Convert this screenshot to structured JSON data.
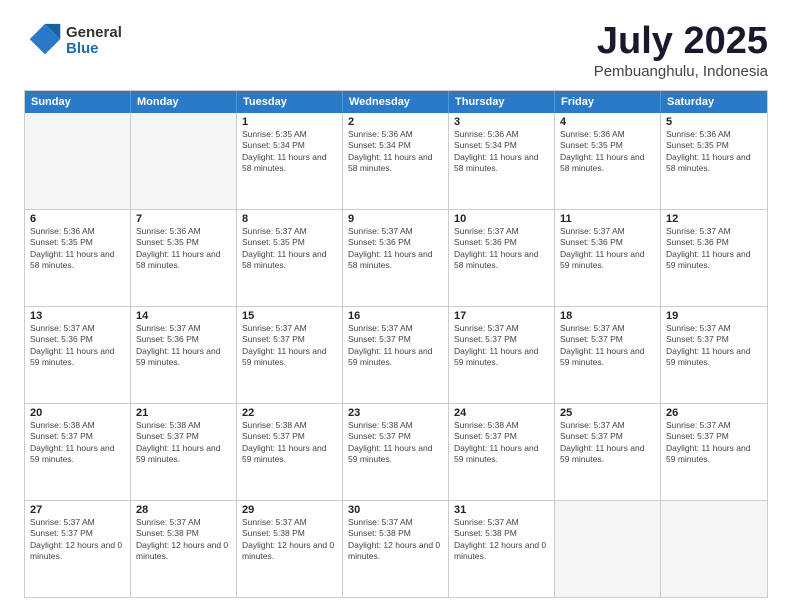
{
  "logo": {
    "general": "General",
    "blue": "Blue"
  },
  "header": {
    "month": "July 2025",
    "location": "Pembuanghulu, Indonesia"
  },
  "weekdays": [
    "Sunday",
    "Monday",
    "Tuesday",
    "Wednesday",
    "Thursday",
    "Friday",
    "Saturday"
  ],
  "weeks": [
    [
      {
        "day": "",
        "detail": ""
      },
      {
        "day": "",
        "detail": ""
      },
      {
        "day": "1",
        "detail": "Sunrise: 5:35 AM\nSunset: 5:34 PM\nDaylight: 11 hours and 58 minutes."
      },
      {
        "day": "2",
        "detail": "Sunrise: 5:36 AM\nSunset: 5:34 PM\nDaylight: 11 hours and 58 minutes."
      },
      {
        "day": "3",
        "detail": "Sunrise: 5:36 AM\nSunset: 5:34 PM\nDaylight: 11 hours and 58 minutes."
      },
      {
        "day": "4",
        "detail": "Sunrise: 5:36 AM\nSunset: 5:35 PM\nDaylight: 11 hours and 58 minutes."
      },
      {
        "day": "5",
        "detail": "Sunrise: 5:36 AM\nSunset: 5:35 PM\nDaylight: 11 hours and 58 minutes."
      }
    ],
    [
      {
        "day": "6",
        "detail": "Sunrise: 5:36 AM\nSunset: 5:35 PM\nDaylight: 11 hours and 58 minutes."
      },
      {
        "day": "7",
        "detail": "Sunrise: 5:36 AM\nSunset: 5:35 PM\nDaylight: 11 hours and 58 minutes."
      },
      {
        "day": "8",
        "detail": "Sunrise: 5:37 AM\nSunset: 5:35 PM\nDaylight: 11 hours and 58 minutes."
      },
      {
        "day": "9",
        "detail": "Sunrise: 5:37 AM\nSunset: 5:36 PM\nDaylight: 11 hours and 58 minutes."
      },
      {
        "day": "10",
        "detail": "Sunrise: 5:37 AM\nSunset: 5:36 PM\nDaylight: 11 hours and 58 minutes."
      },
      {
        "day": "11",
        "detail": "Sunrise: 5:37 AM\nSunset: 5:36 PM\nDaylight: 11 hours and 59 minutes."
      },
      {
        "day": "12",
        "detail": "Sunrise: 5:37 AM\nSunset: 5:36 PM\nDaylight: 11 hours and 59 minutes."
      }
    ],
    [
      {
        "day": "13",
        "detail": "Sunrise: 5:37 AM\nSunset: 5:36 PM\nDaylight: 11 hours and 59 minutes."
      },
      {
        "day": "14",
        "detail": "Sunrise: 5:37 AM\nSunset: 5:36 PM\nDaylight: 11 hours and 59 minutes."
      },
      {
        "day": "15",
        "detail": "Sunrise: 5:37 AM\nSunset: 5:37 PM\nDaylight: 11 hours and 59 minutes."
      },
      {
        "day": "16",
        "detail": "Sunrise: 5:37 AM\nSunset: 5:37 PM\nDaylight: 11 hours and 59 minutes."
      },
      {
        "day": "17",
        "detail": "Sunrise: 5:37 AM\nSunset: 5:37 PM\nDaylight: 11 hours and 59 minutes."
      },
      {
        "day": "18",
        "detail": "Sunrise: 5:37 AM\nSunset: 5:37 PM\nDaylight: 11 hours and 59 minutes."
      },
      {
        "day": "19",
        "detail": "Sunrise: 5:37 AM\nSunset: 5:37 PM\nDaylight: 11 hours and 59 minutes."
      }
    ],
    [
      {
        "day": "20",
        "detail": "Sunrise: 5:38 AM\nSunset: 5:37 PM\nDaylight: 11 hours and 59 minutes."
      },
      {
        "day": "21",
        "detail": "Sunrise: 5:38 AM\nSunset: 5:37 PM\nDaylight: 11 hours and 59 minutes."
      },
      {
        "day": "22",
        "detail": "Sunrise: 5:38 AM\nSunset: 5:37 PM\nDaylight: 11 hours and 59 minutes."
      },
      {
        "day": "23",
        "detail": "Sunrise: 5:38 AM\nSunset: 5:37 PM\nDaylight: 11 hours and 59 minutes."
      },
      {
        "day": "24",
        "detail": "Sunrise: 5:38 AM\nSunset: 5:37 PM\nDaylight: 11 hours and 59 minutes."
      },
      {
        "day": "25",
        "detail": "Sunrise: 5:37 AM\nSunset: 5:37 PM\nDaylight: 11 hours and 59 minutes."
      },
      {
        "day": "26",
        "detail": "Sunrise: 5:37 AM\nSunset: 5:37 PM\nDaylight: 11 hours and 59 minutes."
      }
    ],
    [
      {
        "day": "27",
        "detail": "Sunrise: 5:37 AM\nSunset: 5:37 PM\nDaylight: 12 hours and 0 minutes."
      },
      {
        "day": "28",
        "detail": "Sunrise: 5:37 AM\nSunset: 5:38 PM\nDaylight: 12 hours and 0 minutes."
      },
      {
        "day": "29",
        "detail": "Sunrise: 5:37 AM\nSunset: 5:38 PM\nDaylight: 12 hours and 0 minutes."
      },
      {
        "day": "30",
        "detail": "Sunrise: 5:37 AM\nSunset: 5:38 PM\nDaylight: 12 hours and 0 minutes."
      },
      {
        "day": "31",
        "detail": "Sunrise: 5:37 AM\nSunset: 5:38 PM\nDaylight: 12 hours and 0 minutes."
      },
      {
        "day": "",
        "detail": ""
      },
      {
        "day": "",
        "detail": ""
      }
    ]
  ]
}
